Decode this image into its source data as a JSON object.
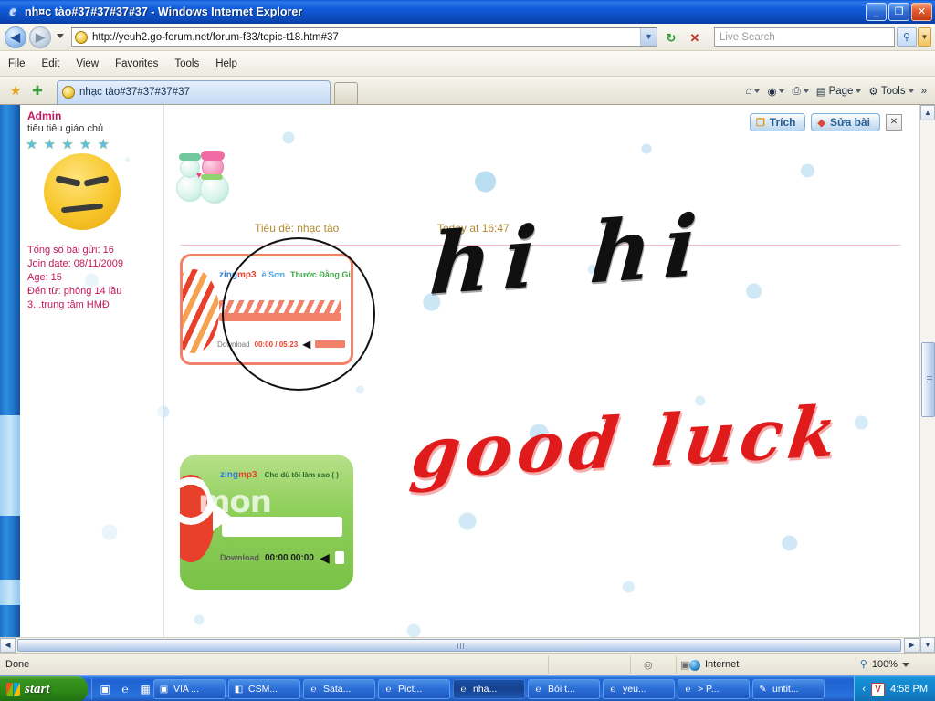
{
  "window": {
    "title": "nh¤c tào#37#37#37#37 - Windows Internet Explorer",
    "icon": "ie-logo-icon",
    "minimize": "_",
    "restore": "❐",
    "close": "✕"
  },
  "nav": {
    "back": "◀",
    "forward": "▶",
    "history_caret": "▾",
    "url": "http://yeuh2.go-forum.net/forum-f33/topic-t18.htm#37",
    "url_dropdown": "▼",
    "refresh": "↻",
    "stop": "✕",
    "search_placeholder": "Live Search",
    "search_go": "🔍",
    "search_dropdown": "▼"
  },
  "menu": {
    "items": [
      "File",
      "Edit",
      "View",
      "Favorites",
      "Tools",
      "Help"
    ]
  },
  "tabbar": {
    "fav_star": "★",
    "fav_add": "✚",
    "tab_label": "nhạc tào#37#37#37#37",
    "newtab": "",
    "commands": [
      {
        "label": "",
        "icon": "home-icon",
        "glyph": "⌂",
        "caret": "▾"
      },
      {
        "label": "",
        "icon": "rss-icon",
        "glyph": "◉",
        "caret": "▾"
      },
      {
        "label": "",
        "icon": "print-icon",
        "glyph": "⎙",
        "caret": "▾"
      },
      {
        "label": "Page",
        "icon": "page-icon",
        "glyph": "▤",
        "caret": "▾"
      },
      {
        "label": "Tools",
        "icon": "gear-icon",
        "glyph": "⚙",
        "caret": "▾"
      },
      {
        "label": "",
        "icon": "overflow-icon",
        "glyph": "»",
        "caret": ""
      }
    ]
  },
  "profile": {
    "username": "Admin",
    "rank": "tiêu tiêu giáo chủ",
    "stars": "★ ★ ★ ★ ★",
    "avatar": "angry-face-avatar",
    "stats": [
      "Tổng số bài gửi: 16",
      "Join date: 08/11/2009",
      "Age: 15",
      "Đến từ: phòng 14  lầu",
      "3...trung tâm HMĐ"
    ]
  },
  "post": {
    "subject": "Tiêu đề: nhạc tào",
    "time": "Today at 16:47",
    "quote_button": "Trích",
    "edit_button": "Sửa bài",
    "close_button": "✕",
    "handwriting_black": "hi hi",
    "handwriting_red": "good luck",
    "snowman": "snowman-image"
  },
  "player1": {
    "brand_z": "zing",
    "brand_m": "mp3",
    "title": "ề Sơn",
    "artist": "Thước Đằng Gib",
    "download": "Download",
    "time": "00:00 / 05:23",
    "prev": "◀"
  },
  "player2": {
    "brand_z": "zing",
    "brand_m": "mp3",
    "watermark": "mon",
    "title": "Cho dù tôi làm sao ( )",
    "download": "Download",
    "time": "00:00  00:00",
    "prev": "◀"
  },
  "scrollbars": {
    "up": "▲",
    "down": "▼",
    "left": "◀",
    "right": "▶"
  },
  "statusbar": {
    "status": "Done",
    "zone": "Internet",
    "zoom": "100%",
    "zoom_caret": "▾",
    "zoom_icon": "🔍",
    "icon1": "privacy-icon",
    "icon2": "blocked-icon",
    "glyph1": "◎",
    "glyph2": "▣"
  },
  "taskbar": {
    "start": "start",
    "quicklaunch": [
      {
        "name": "show-desktop-icon",
        "glyph": "▣"
      },
      {
        "name": "internet-explorer-icon",
        "glyph": "℮"
      },
      {
        "name": "media-player-icon",
        "glyph": "▦"
      },
      {
        "name": "overflow-icon",
        "glyph": "»"
      }
    ],
    "tasks": [
      {
        "label": "VIA ...",
        "glyph": "▣",
        "active": false
      },
      {
        "label": "CSM...",
        "glyph": "◧",
        "active": false
      },
      {
        "label": "Sata...",
        "glyph": "℮",
        "active": false
      },
      {
        "label": "Pict...",
        "glyph": "℮",
        "active": false
      },
      {
        "label": "nha...",
        "glyph": "℮",
        "active": true
      },
      {
        "label": "Bói t...",
        "glyph": "℮",
        "active": false
      },
      {
        "label": "yeu...",
        "glyph": "℮",
        "active": false
      },
      {
        "label": "> P...",
        "glyph": "℮",
        "active": false
      },
      {
        "label": "untit...",
        "glyph": "✎",
        "active": false
      }
    ],
    "tray_chevron": "‹",
    "tray_badge": "V",
    "clock": "4:58 PM"
  },
  "colors": {
    "title_blue": "#0f5ad9",
    "accent_pink": "#c2185b",
    "gold_text": "#b08a30",
    "red_hand": "#e01b1b",
    "player1_border": "#f2816a",
    "player2_green": "#8fcf5c"
  }
}
